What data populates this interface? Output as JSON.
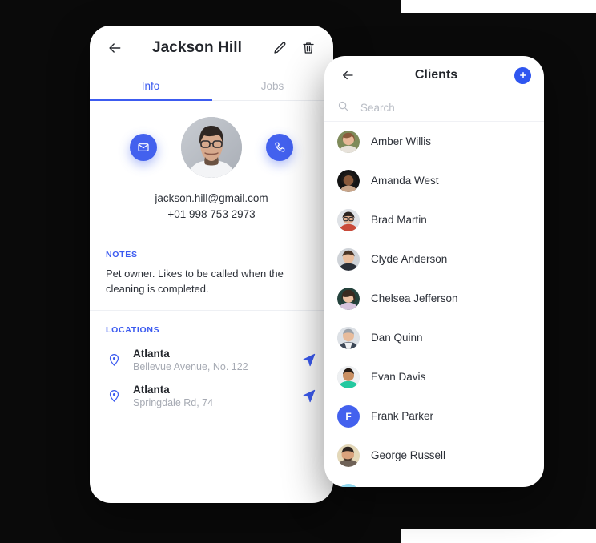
{
  "detail": {
    "header": {
      "back_icon": "arrow-left-icon",
      "title": "Jackson Hill",
      "edit_icon": "pencil-icon",
      "delete_icon": "trash-icon"
    },
    "tabs": [
      {
        "label": "Info",
        "active": true
      },
      {
        "label": "Jobs",
        "active": false
      }
    ],
    "actions": {
      "email_icon": "envelope-icon",
      "call_icon": "phone-icon"
    },
    "avatar": "profile-photo-jackson-hill",
    "email": "jackson.hill@gmail.com",
    "phone": "+01 998 753 2973",
    "notes": {
      "label": "NOTES",
      "body": "Pet owner. Likes to be called when the cleaning is completed."
    },
    "locations": {
      "label": "LOCATIONS",
      "items": [
        {
          "city": "Atlanta",
          "address": "Bellevue Avenue, No. 122"
        },
        {
          "city": "Atlanta",
          "address": "Springdale Rd, 74"
        }
      ]
    }
  },
  "clients": {
    "header": {
      "back_icon": "arrow-left-icon",
      "title": "Clients",
      "add_icon": "plus-icon"
    },
    "search": {
      "icon": "search-icon",
      "placeholder": "Search",
      "value": ""
    },
    "items": [
      {
        "name": "Amber Willis",
        "avatar_type": "photo",
        "avatar_color": "#c9a18a"
      },
      {
        "name": "Amanda West",
        "avatar_type": "photo",
        "avatar_color": "#4a3b33"
      },
      {
        "name": "Brad Martin",
        "avatar_type": "photo",
        "avatar_color": "#c2c6cc"
      },
      {
        "name": "Clyde Anderson",
        "avatar_type": "photo",
        "avatar_color": "#6d5b4e"
      },
      {
        "name": "Chelsea Jefferson",
        "avatar_type": "photo",
        "avatar_color": "#2e4f4a"
      },
      {
        "name": "Dan Quinn",
        "avatar_type": "photo",
        "avatar_color": "#b9bec6"
      },
      {
        "name": "Evan Davis",
        "avatar_type": "photo",
        "avatar_color": "#27c89a"
      },
      {
        "name": "Frank Parker",
        "avatar_type": "initial",
        "initial": "F",
        "avatar_color": "#4361ee"
      },
      {
        "name": "George Russell",
        "avatar_type": "photo",
        "avatar_color": "#d9c6a3"
      },
      {
        "name": "",
        "avatar_type": "photo",
        "avatar_color": "#6fc9e8"
      }
    ]
  },
  "colors": {
    "accent": "#4361ee",
    "accent_alt": "#3c5bf0",
    "text_primary": "#2c3038",
    "text_muted": "#a6aab3",
    "background": "#0a0a0a",
    "card": "#ffffff"
  }
}
